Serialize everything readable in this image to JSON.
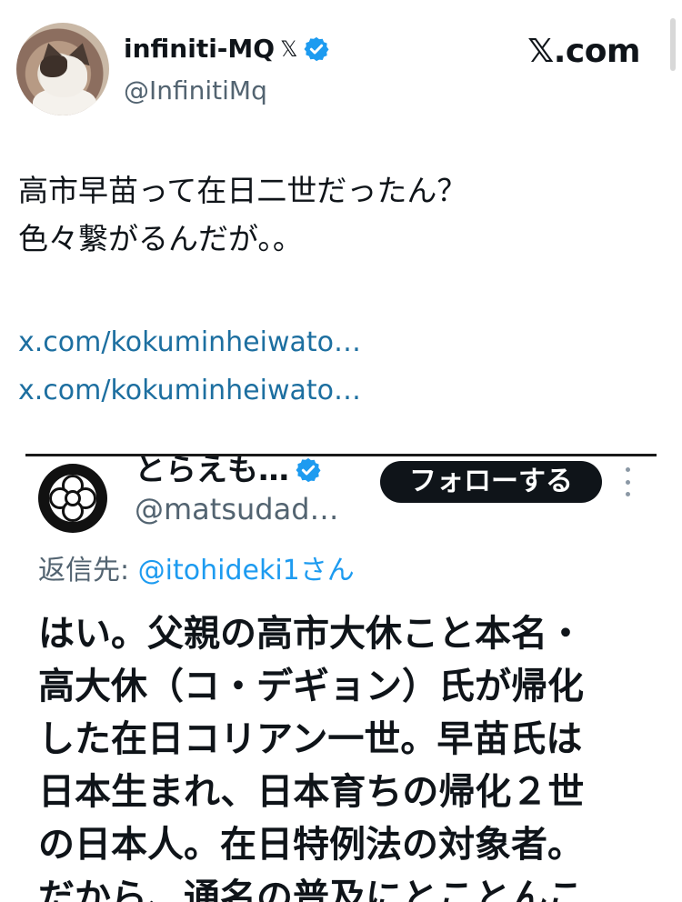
{
  "author": {
    "display_name": "infiniti-MQ",
    "handle": "@InfinitiMq",
    "x_badge": "𝕏",
    "verified_icon": "verified-badge-icon"
  },
  "site_label": "𝕏.com",
  "tweet": {
    "text": "高市早苗って在日二世だったん？\n色々繋がるんだが。。",
    "link1": "x.com/kokuminheiwato…",
    "link2": "x.com/kokuminheiwato…"
  },
  "embedded_post": {
    "display_name": "とらえも…",
    "handle": "@matsudad…",
    "follow_label": "フォローする",
    "reply_prefix": "返信先: ",
    "reply_mention": "@itohideki1さん",
    "text": "はい。父親の高市大休こと本名・\n高大休（コ・デギョン）氏が帰化\nした在日コリアン一世。早苗氏は\n日本生まれ、日本育ちの帰化２世\nの日本人。在日特例法の対象者。\nだから、通名の普及にとことんこ"
  },
  "colors": {
    "link": "#1d6fa0",
    "verified": "#1d9bf0",
    "muted": "#536471",
    "follow_button": "#0f1419"
  }
}
